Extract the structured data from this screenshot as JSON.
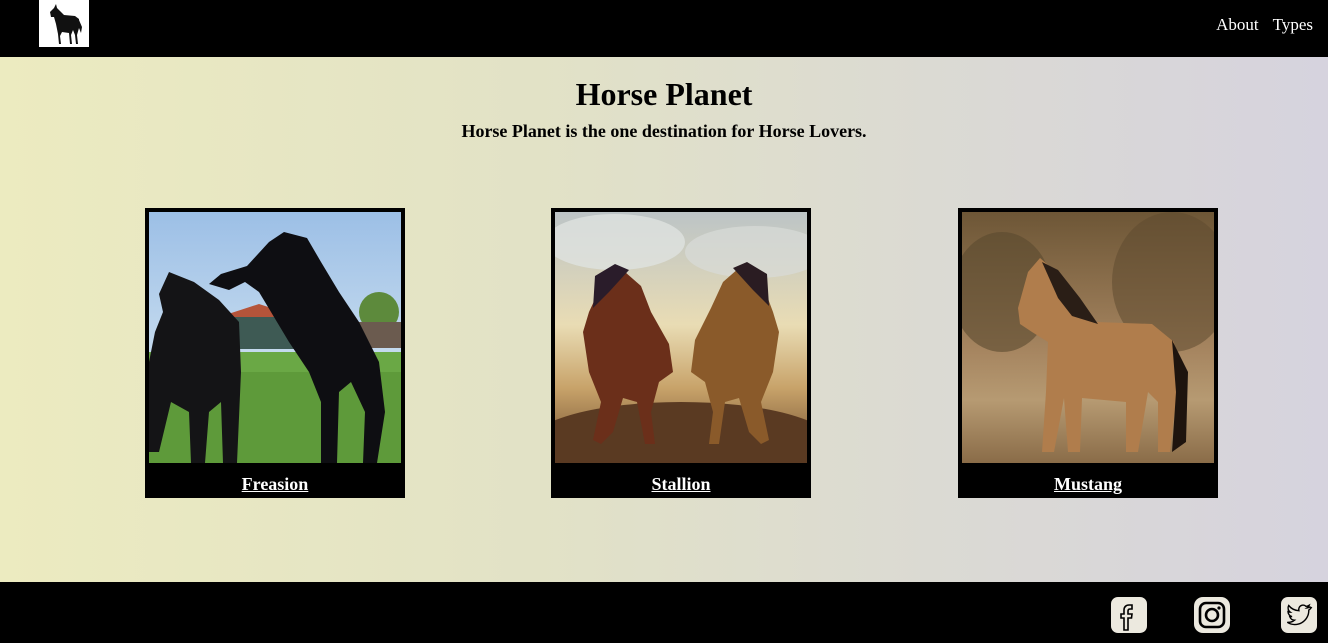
{
  "header": {
    "logo_icon": "horse-silhouette-icon",
    "nav": [
      {
        "label": "About"
      },
      {
        "label": "Types"
      }
    ]
  },
  "hero": {
    "title": "Horse Planet",
    "subtitle": "Horse Planet is the one destination for Horse Lovers."
  },
  "cards": [
    {
      "label": "Freasion"
    },
    {
      "label": "Stallion"
    },
    {
      "label": "Mustang"
    }
  ],
  "footer": {
    "social": [
      {
        "icon": "facebook-icon"
      },
      {
        "icon": "instagram-icon"
      },
      {
        "icon": "twitter-icon"
      }
    ]
  },
  "colors": {
    "bar": "#000000",
    "gradient_start": "#ecebc0",
    "gradient_end": "#d6d3de"
  }
}
